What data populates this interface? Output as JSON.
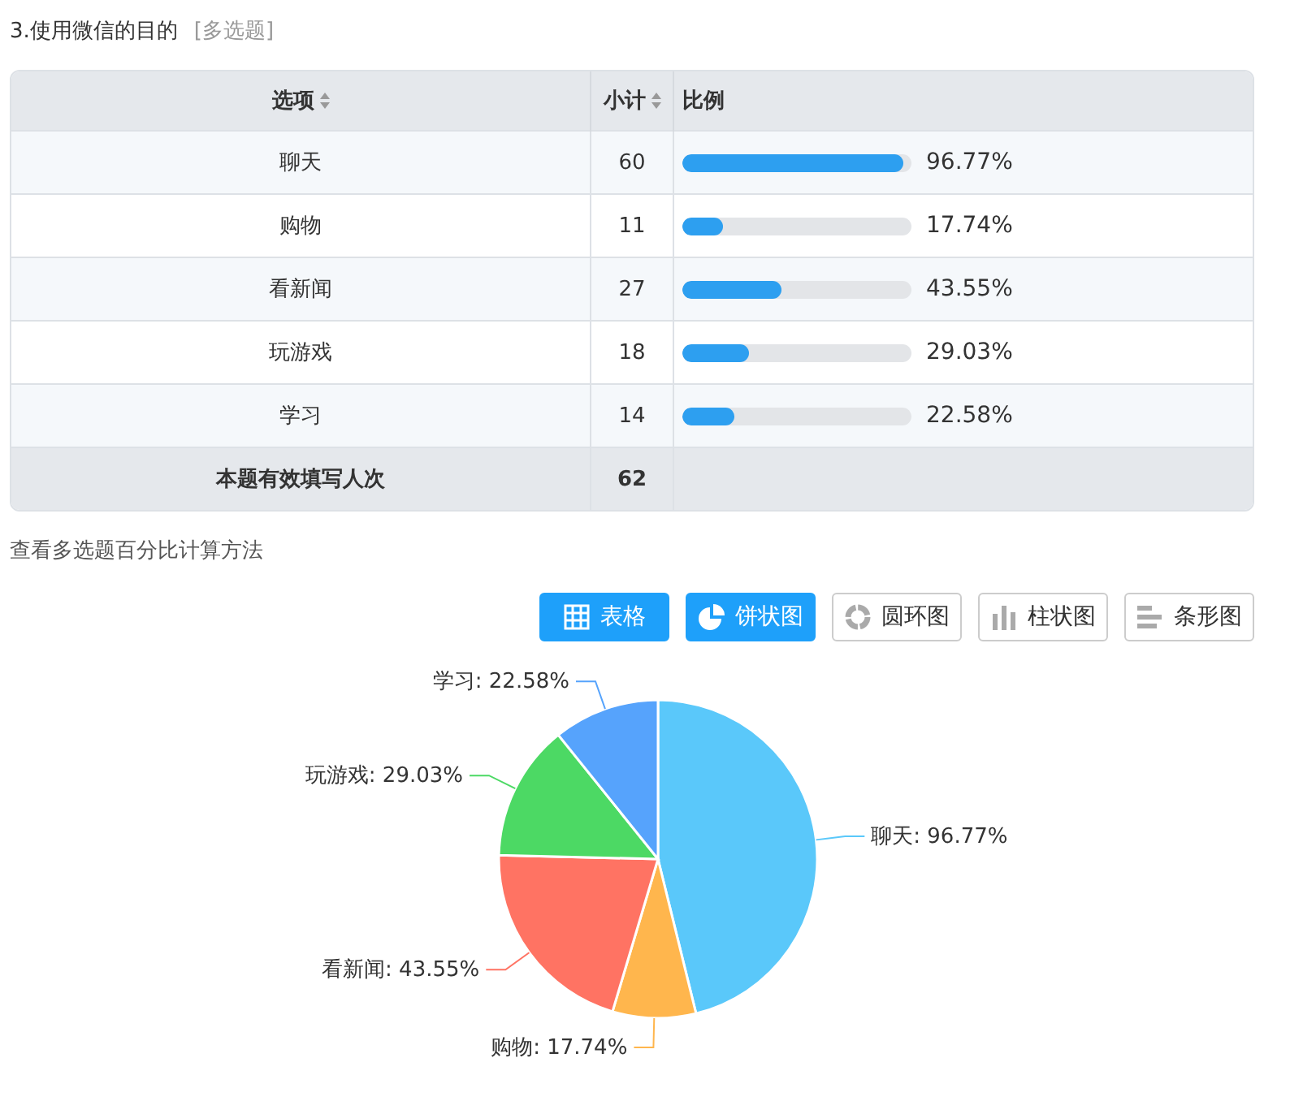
{
  "question": {
    "title": "3.使用微信的目的",
    "type_tag": "[多选题]"
  },
  "table": {
    "columns": [
      {
        "label": "选项",
        "sortable": true
      },
      {
        "label": "小计",
        "sortable": true
      },
      {
        "label": "比例",
        "sortable": false
      }
    ],
    "rows": [
      {
        "option": "聊天",
        "count": "60",
        "level": 0.9677,
        "percent": "96.77%"
      },
      {
        "option": "购物",
        "count": "11",
        "level": 0.1774,
        "percent": "17.74%"
      },
      {
        "option": "看新闻",
        "count": "27",
        "level": 0.4355,
        "percent": "43.55%"
      },
      {
        "option": "玩游戏",
        "count": "18",
        "level": 0.2903,
        "percent": "29.03%"
      },
      {
        "option": "学习",
        "count": "14",
        "level": 0.2258,
        "percent": "22.58%"
      }
    ],
    "footer": {
      "label": "本题有效填写人次",
      "total": "62"
    }
  },
  "help_link": "查看多选题百分比计算方法",
  "view_buttons": [
    {
      "label": "表格",
      "kind": "table",
      "selected": true
    },
    {
      "label": "饼状图",
      "kind": "pie",
      "selected": true
    },
    {
      "label": "圆环图",
      "kind": "donut",
      "selected": false
    },
    {
      "label": "柱状图",
      "kind": "bar",
      "selected": false
    },
    {
      "label": "条形图",
      "kind": "hbar",
      "selected": false
    }
  ],
  "chart": {
    "chart_data": {
      "type": "pie",
      "values": [
        96.77,
        17.74,
        43.55,
        29.03,
        22.58
      ],
      "colors": [
        "#5ac8fa",
        "#ffb64d",
        "#ff7363",
        "#4cd964",
        "#56a3fc"
      ],
      "value_labels": [
        "聊天: 96.77%",
        "购物: 17.74%",
        "看新闻: 43.55%",
        "玩游戏: 29.03%",
        "学习: 22.58%"
      ]
    }
  }
}
